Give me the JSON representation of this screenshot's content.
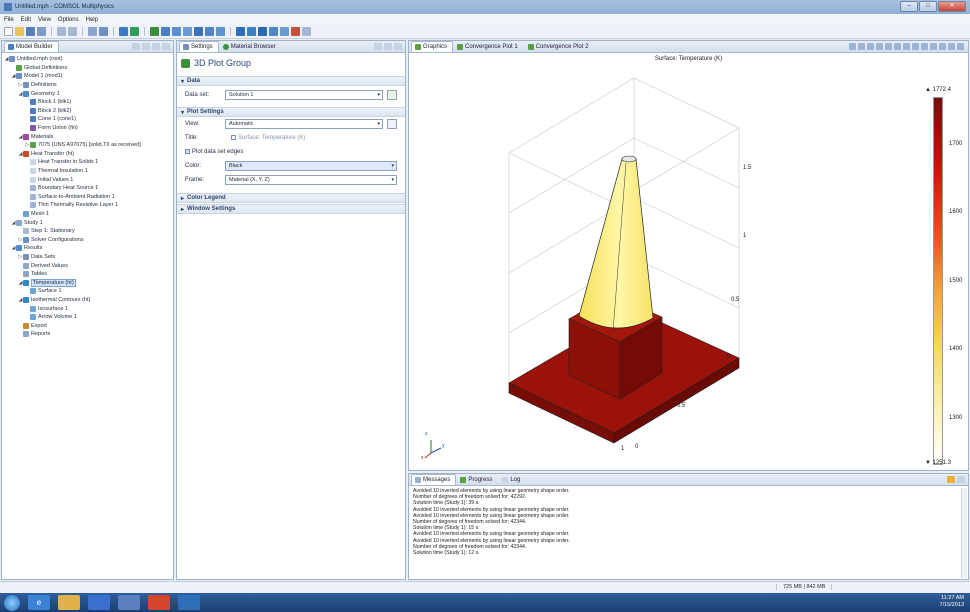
{
  "window": {
    "title": "Untitled.mph - COMSOL Multiphysics",
    "controls": [
      "–",
      "□",
      "✕"
    ]
  },
  "menu": [
    "File",
    "Edit",
    "View",
    "Options",
    "Help"
  ],
  "model_builder": {
    "tab": "Model Builder",
    "tree": [
      {
        "label": "Untitled.mph (root)",
        "level": 0,
        "exp": "◢",
        "icon": "#6c8fc4"
      },
      {
        "label": "Global Definitions",
        "level": 1,
        "exp": "",
        "icon": "#5aa04a"
      },
      {
        "label": "Model 1 (mod1)",
        "level": 1,
        "exp": "◢",
        "icon": "#6c8fc4"
      },
      {
        "label": "Definitions",
        "level": 2,
        "exp": "▷",
        "icon": "#7a8fb8"
      },
      {
        "label": "Geometry 1",
        "level": 2,
        "exp": "◢",
        "icon": "#4d8ad1"
      },
      {
        "label": "Block 1 (blk1)",
        "level": 3,
        "exp": "",
        "icon": "#4c7fc0"
      },
      {
        "label": "Block 2 (blk2)",
        "level": 3,
        "exp": "",
        "icon": "#4c7fc0"
      },
      {
        "label": "Cone 1 (cone1)",
        "level": 3,
        "exp": "",
        "icon": "#4c7fc0"
      },
      {
        "label": "Form Union (fin)",
        "level": 3,
        "exp": "",
        "icon": "#7d5aa8"
      },
      {
        "label": "Materials",
        "level": 2,
        "exp": "◢",
        "icon": "#9b4b9a"
      },
      {
        "label": "7075 (UNS A97075) [solid,T6 as received]",
        "level": 3,
        "exp": "▷",
        "icon": "#5aa04a"
      },
      {
        "label": "Heat Transfer (ht)",
        "level": 2,
        "exp": "◢",
        "icon": "#d14a1f"
      },
      {
        "label": "Heat Transfer in Solids 1",
        "level": 3,
        "exp": "",
        "icon": "#c9d6ea"
      },
      {
        "label": "Thermal Insulation 1",
        "level": 3,
        "exp": "",
        "icon": "#c9d6ea"
      },
      {
        "label": "Initial Values 1",
        "level": 3,
        "exp": "",
        "icon": "#c9d6ea"
      },
      {
        "label": "Boundary Heat Source 1",
        "level": 3,
        "exp": "",
        "icon": "#9fb4d6"
      },
      {
        "label": "Surface-to-Ambient Radiation 1",
        "level": 3,
        "exp": "",
        "icon": "#9fb4d6"
      },
      {
        "label": "Thin Thermally Resistive Layer 1",
        "level": 3,
        "exp": "",
        "icon": "#9fb4d6"
      },
      {
        "label": "Mesh 1",
        "level": 2,
        "exp": "",
        "icon": "#6fa0c8"
      },
      {
        "label": "Study 1",
        "level": 1,
        "exp": "◢",
        "icon": "#8aa7cf"
      },
      {
        "label": "Step 1: Stationary",
        "level": 2,
        "exp": "",
        "icon": "#aab9d0"
      },
      {
        "label": "Solver Configurations",
        "level": 2,
        "exp": "▷",
        "icon": "#6a8fc0"
      },
      {
        "label": "Results",
        "level": 1,
        "exp": "◢",
        "icon": "#4d8ad1"
      },
      {
        "label": "Data Sets",
        "level": 2,
        "exp": "▷",
        "icon": "#7a8fb8"
      },
      {
        "label": "Derived Values",
        "level": 2,
        "exp": "",
        "icon": "#8fa6c8"
      },
      {
        "label": "Tables",
        "level": 2,
        "exp": "",
        "icon": "#8fa6c8"
      },
      {
        "label": "Temperature (ht)",
        "level": 2,
        "exp": "◢",
        "icon": "#2f86c9",
        "selected": true
      },
      {
        "label": "Surface 1",
        "level": 3,
        "exp": "",
        "icon": "#6aa6d8"
      },
      {
        "label": "Isothermal Contours (ht)",
        "level": 2,
        "exp": "◢",
        "icon": "#2f86c9"
      },
      {
        "label": "Isosurface 1",
        "level": 3,
        "exp": "",
        "icon": "#6aa6d8"
      },
      {
        "label": "Arrow Volume 1",
        "level": 3,
        "exp": "",
        "icon": "#6aa6d8"
      },
      {
        "label": "Export",
        "level": 2,
        "exp": "",
        "icon": "#c98a2f"
      },
      {
        "label": "Reports",
        "level": 2,
        "exp": "",
        "icon": "#8fa6c8"
      }
    ]
  },
  "settings": {
    "tabs": [
      "Settings",
      "Material Browser"
    ],
    "title": "3D Plot Group",
    "sections": {
      "data": "Data",
      "plot_settings": "Plot Settings",
      "color_legend": "Color Legend",
      "window_settings": "Window Settings"
    },
    "fields": {
      "data_set_label": "Data set:",
      "data_set_value": "Solution 1",
      "view_label": "View:",
      "view_value": "Automatic",
      "title_label": "Title:",
      "title_value": "Surface: Temperature (K)",
      "plot_edges_label": "Plot data set edges",
      "color_label": "Color:",
      "color_value": "Black",
      "frame_label": "Frame:",
      "frame_value": "Material (X, Y, Z)"
    }
  },
  "graphics": {
    "tabs": [
      "Graphics",
      "Convergence Plot 1",
      "Convergence Plot 2"
    ],
    "plot_title": "Surface: Temperature (K)",
    "legend": {
      "max": "▲ 1772.4",
      "min": "▼ 1251.3",
      "ticks": [
        "1700",
        "1600",
        "1500",
        "1400",
        "1300"
      ],
      "max_value": 1772.4,
      "min_value": 1251.3
    },
    "axis_labels": {
      "z": [
        "1.5",
        "1",
        "0.5",
        "0"
      ],
      "x": [
        "0",
        "0.5",
        "1"
      ],
      "y": [
        "0",
        "0.5"
      ]
    },
    "triad": {
      "z": "z",
      "y": "y",
      "x": "x"
    },
    "colors": {
      "body": "#8a0f0a",
      "cone_top": "#fff7a8",
      "cone_base": "#f3e15a"
    }
  },
  "messages": {
    "tabs": [
      "Messages",
      "Progress",
      "Log"
    ],
    "lines": [
      "Avoided 10 inverted elements by using linear geometry shape order.",
      "Number of degrees of freedom solved for: 42292.",
      "Solution time (Study 1): 39 s.",
      "Avoided 10 inverted elements by using linear geometry shape order.",
      "Avoided 10 inverted elements by using linear geometry shape order.",
      "Number of degrees of freedom solved for: 42344.",
      "Solution time (Study 1): 15 s.",
      "Avoided 10 inverted elements by using linear geometry shape order.",
      "Avoided 10 inverted elements by using linear geometry shape order.",
      "Number of degrees of freedom solved for: 42344.",
      "Solution time (Study 1): 12 s."
    ]
  },
  "status": {
    "memory": "725 MB | 842 MB"
  },
  "taskbar": {
    "time": "11:27 AM",
    "date": "7/15/2013"
  }
}
